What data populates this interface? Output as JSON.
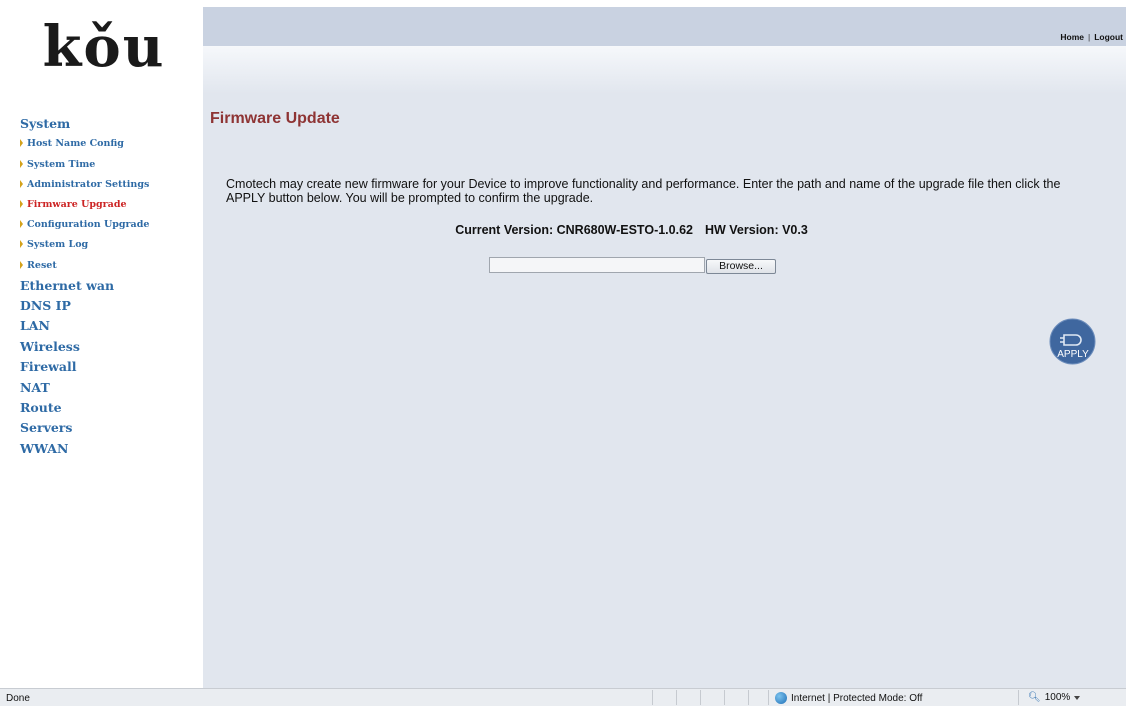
{
  "logo": {
    "text": "kǒu"
  },
  "header": {
    "links": {
      "home": "Home",
      "separator": "|",
      "logout": "Logout"
    }
  },
  "sidebar": {
    "groups": [
      {
        "label": "System",
        "items": [
          {
            "label": "Host Name Config",
            "active": false
          },
          {
            "label": "System Time",
            "active": false
          },
          {
            "label": "Administrator Settings",
            "active": false
          },
          {
            "label": "Firmware Upgrade",
            "active": true
          },
          {
            "label": "Configuration Upgrade",
            "active": false
          },
          {
            "label": "System Log",
            "active": false
          },
          {
            "label": "Reset",
            "active": false
          }
        ]
      },
      {
        "label": "Ethernet wan"
      },
      {
        "label": "DNS IP"
      },
      {
        "label": "LAN"
      },
      {
        "label": "Wireless"
      },
      {
        "label": "Firewall"
      },
      {
        "label": "NAT"
      },
      {
        "label": "Route"
      },
      {
        "label": "Servers"
      },
      {
        "label": "WWAN"
      }
    ]
  },
  "main": {
    "title": "Firmware Update",
    "description": "Cmotech may create new firmware for your Device to improve functionality and performance. Enter the path and name of the upgrade file then click the APPLY button below. You will be prompted to confirm the upgrade.",
    "current_version": "Current Version: CNR680W-ESTO-1.0.62",
    "hw_version": "HW Version: V0.3",
    "file_input": {
      "value": ""
    },
    "browse_label": "Browse...",
    "apply_label": "APPLY"
  },
  "statusbar": {
    "status": "Done",
    "zone": "Internet | Protected Mode: Off",
    "zoom": "100%"
  },
  "colors": {
    "nav_link": "#2e6aa5",
    "nav_active": "#cc2424",
    "title": "#8e3434",
    "panel_bg": "#e1e6ee",
    "top_bar": "#c9d2e1",
    "apply_button": "#3f679f"
  }
}
